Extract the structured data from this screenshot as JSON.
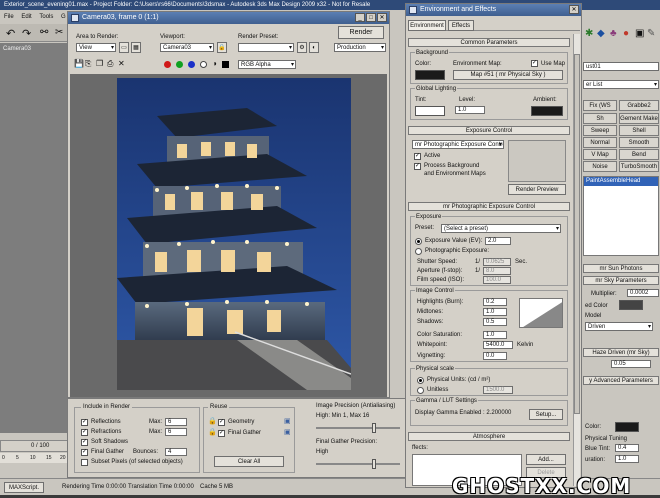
{
  "max": {
    "title": "Exterior_scene_evening01.max - Project Folder: C:\\Users\\rs66\\Documents\\3dsmax - Autodesk 3ds Max Design 2009 x32 - Not for Resale",
    "menu": [
      "File",
      "Edit",
      "Tools",
      "G"
    ],
    "viewport_label": "Camera03",
    "timeline": "0 / 100",
    "track_numbers": [
      "0",
      "5",
      "10",
      "15",
      "20"
    ],
    "script_label": "MAXScript.",
    "status": [
      "Rendering Time 0:00:00",
      "Translation Time 0:00:00",
      "Cache 5 MB"
    ],
    "right_tabs": [
      "Grabbe2",
      "Gement Make",
      "Shell",
      "Smooth",
      "Bend",
      "TurboSmooth"
    ],
    "right_tabs_left": [
      "Fix (WS",
      "Sh",
      "Sweep",
      "Normal",
      "V Map",
      "Noise"
    ],
    "right_items": [
      "PaintAssembleHead",
      "mr Sun Photons",
      "mr Sky Parameters",
      "Multiplier:",
      "0.0002",
      "ed Color",
      "Model",
      "Driven",
      "Haze Driven (mr Sky)",
      "0.05",
      "y Advanced Parameters",
      "Color:",
      "Physical Tuning",
      "Blue Tint:",
      "0.4",
      "uration:",
      "1.0"
    ],
    "obj_name": "ust01",
    "mod_list": "er List"
  },
  "frame": {
    "title": "Camera03, frame 0 (1:1)",
    "area_label": "Area to Render:",
    "area_value": "View",
    "viewport_label": "Viewport:",
    "viewport_value": "Camera03",
    "preset_label": "Render Preset:",
    "preset_value": "",
    "mode_value": "Production",
    "render_button": "Render",
    "channel_value": "RGB Alpha",
    "colors": {
      "red": "#d01818",
      "green": "#10a020",
      "blue": "#1a30c8",
      "white": "#ffffff",
      "night": "#1a3470",
      "dusk": "#0c1a3a"
    }
  },
  "bottom": {
    "include_title": "Include in Render",
    "reflections": "Reflections",
    "refractions": "Refractions",
    "soft_shadows": "Soft Shadows",
    "final_gather": "Final Gather",
    "subset": "Subset Pixels (of selected objects)",
    "max_label": "Max:",
    "max_refl": "6",
    "max_refr": "6",
    "bounces_label": "Bounces:",
    "bounces_value": "4",
    "reuse_title": "Reuse",
    "geometry": "Geometry",
    "final_gather_reuse": "Final Gather",
    "clear_all": "Clear All",
    "img_precision_title": "Image Precision (Antialiasing)",
    "img_precision_value": "High: Min 1, Max 16",
    "fg_precision_title": "Final Gather Precision:",
    "fg_precision_value": "High"
  },
  "env": {
    "title": "Environment and Effects",
    "tabs": [
      "Environment",
      "Effects"
    ],
    "common_params": "Common Parameters",
    "background": "Background",
    "color_label": "Color:",
    "env_map_label": "Environment Map:",
    "use_map": "Use Map",
    "map_button": "Map #51  ( mr Physical Sky )",
    "global_lighting": "Global Lighting",
    "tint_label": "Tint:",
    "level_label": "Level:",
    "level_value": "1.0",
    "ambient_label": "Ambient:",
    "exposure_control": "Exposure Control",
    "exposure_select": "mr Photographic Exposure Contro",
    "active": "Active",
    "process_bg": "Process Background",
    "and_env_maps": "and Environment Maps",
    "render_preview": "Render Preview",
    "mr_exposure": "mr Photographic Exposure Control",
    "exposure": "Exposure",
    "preset_label": "Preset:",
    "preset_value": "(Select a preset)",
    "ev_label": "Exposure Value (EV):",
    "ev_value": "2.0",
    "photo_exposure": "Photographic Exposure:",
    "shutter_label": "Shutter Speed:",
    "shutter_value": "0.0625",
    "shutter_unit": "Sec.",
    "aperture_label": "Aperture (f-stop):",
    "aperture_value": "8.0",
    "film_label": "Film speed (ISO):",
    "film_value": "100.0",
    "one_over": "1/",
    "image_control": "Image Control",
    "highlights_label": "Highlights (Burn):",
    "highlights_value": "0.2",
    "midtones_label": "Midtones:",
    "midtones_value": "1.0",
    "shadows_label": "Shadows:",
    "shadows_value": "0.5",
    "saturation_label": "Color Saturation:",
    "saturation_value": "1.0",
    "whitepoint_label": "Whitepoint:",
    "whitepoint_value": "5400.0",
    "whitepoint_unit": "Kelvin",
    "vignetting_label": "Vignetting:",
    "vignetting_value": "0.0",
    "physical_scale": "Physical scale",
    "physical_units": "Physical Units: (cd / m²)",
    "unitless": "Unitless",
    "unitless_value": "1500.0",
    "gamma_title": "Gamma / LUT Settings",
    "gamma_value": "Display Gamma Enabled : 2.200000",
    "setup": "Setup...",
    "atmosphere": "Atmosphere",
    "effects_label": "ffects:",
    "add": "Add...",
    "delete": "Delete"
  },
  "watermark": "GHOSTXX.COM"
}
